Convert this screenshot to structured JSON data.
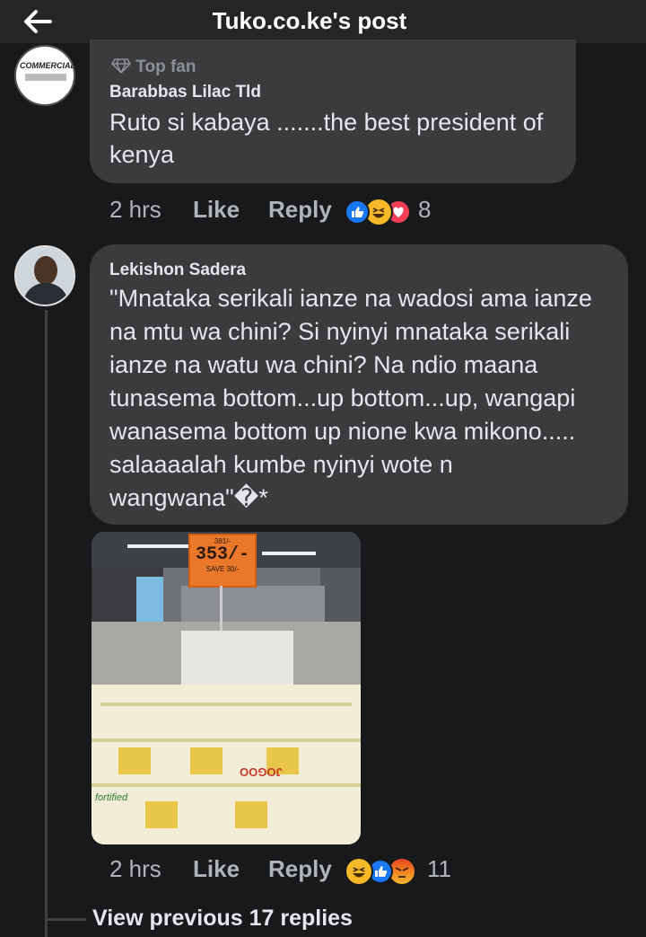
{
  "header": {
    "title": "Tuko.co.ke's post"
  },
  "comment1": {
    "avatar_text": "COMMERCIAL",
    "badge": "Top fan",
    "author": "Barabbas Lilac Tld",
    "text": "Ruto si kabaya .......the best president of\nkenya",
    "time": "2 hrs",
    "like": "Like",
    "reply": "Reply",
    "reaction_count": "8"
  },
  "comment2": {
    "author": "Lekishon Sadera",
    "text": "\"Mnataka serikali ianze na wadosi ama ianze\nna mtu wa chini? Si nyinyi mnataka serikali\nianze na watu wa chini? Na ndio maana\ntunasema bottom...up bottom...up, wangapi\nwanasema bottom up nione kwa mikono.....\nsalaaaalah kumbe nyinyi wote n\nwangwana\"�*",
    "photo": {
      "price_top": "381/-",
      "price": "353/-",
      "save": "SAVE 30/-",
      "bag_brand": "JOGOO",
      "bag_label": "fortified"
    },
    "time": "2 hrs",
    "like": "Like",
    "reply": "Reply",
    "reaction_count": "11"
  },
  "view_previous": "View previous 17 replies",
  "colors": {
    "background": "#18191a",
    "bubble": "#3a3b3c",
    "like_blue": "#1877f2",
    "love_red": "#f33e58",
    "haha_yellow": "#f7b928"
  }
}
